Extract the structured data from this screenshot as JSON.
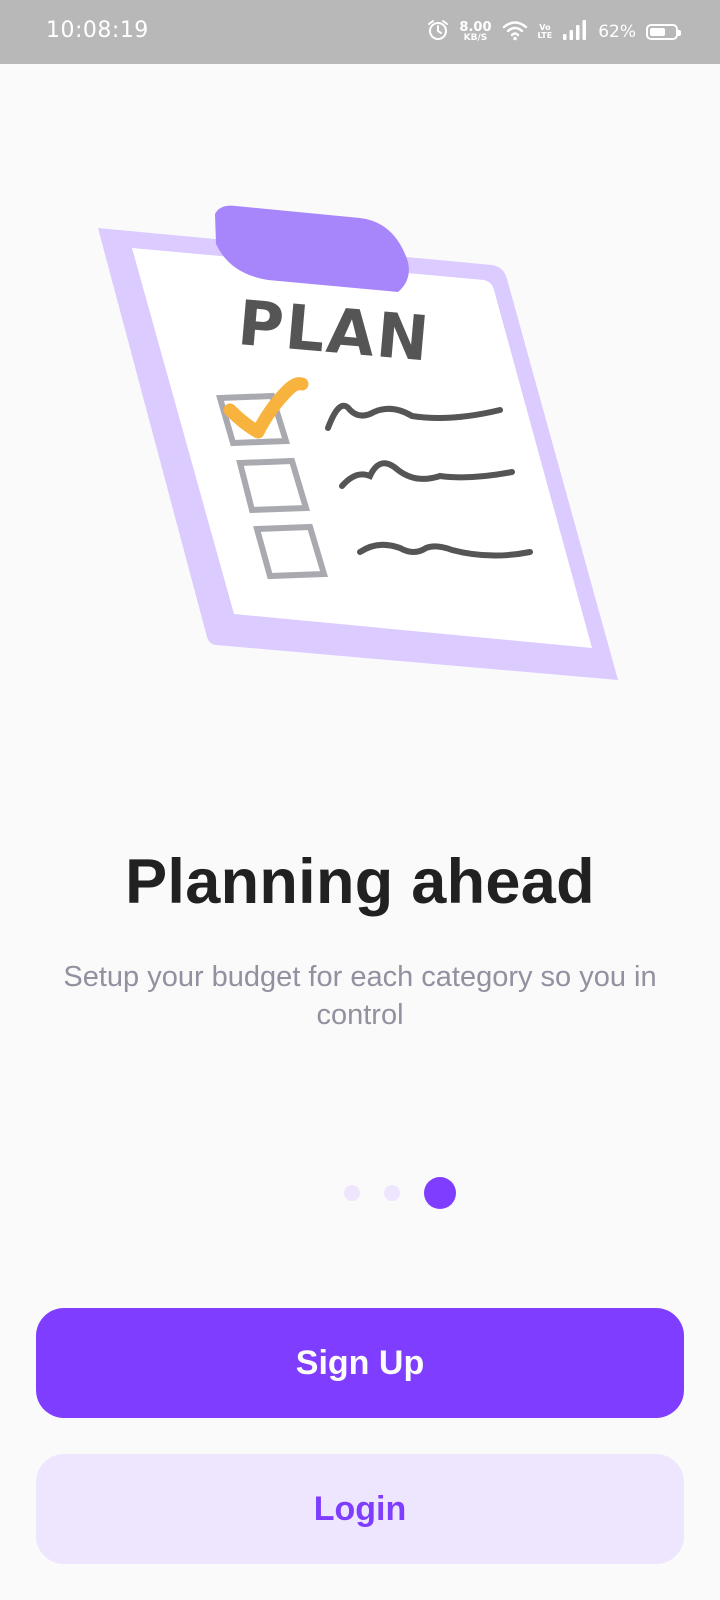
{
  "status_bar": {
    "time": "10:08:19",
    "speed_value": "8.00",
    "speed_unit": "KB/S",
    "volte_top": "Vo",
    "volte_bottom": "LTE",
    "battery_percent": "62%",
    "battery_level": 0.62,
    "icons": [
      "alarm-icon",
      "wifi-icon",
      "volte-icon",
      "signal-icon",
      "battery-icon"
    ]
  },
  "illustration": {
    "clipboard_heading": "PLAN",
    "checklist_items": [
      {
        "checked": true
      },
      {
        "checked": false
      },
      {
        "checked": false
      }
    ],
    "colors": {
      "board": "#DCCBFF",
      "clip": "#A785FB",
      "paper": "#FFFFFF",
      "ink": "#555555",
      "checkbox": "#A9A9B0",
      "checkmark": "#F7B33E"
    }
  },
  "onboarding": {
    "title": "Planning ahead",
    "subtitle": "Setup your budget for each category so you in control",
    "page_count": 3,
    "active_page": 3
  },
  "actions": {
    "signup_label": "Sign Up",
    "login_label": "Login"
  },
  "colors": {
    "primary": "#7F3DFF",
    "primary_light": "#EEE5FF",
    "dot_inactive": "#EEE5FF",
    "background": "#FAFAFA",
    "title": "#212121",
    "subtitle": "#91919F"
  }
}
